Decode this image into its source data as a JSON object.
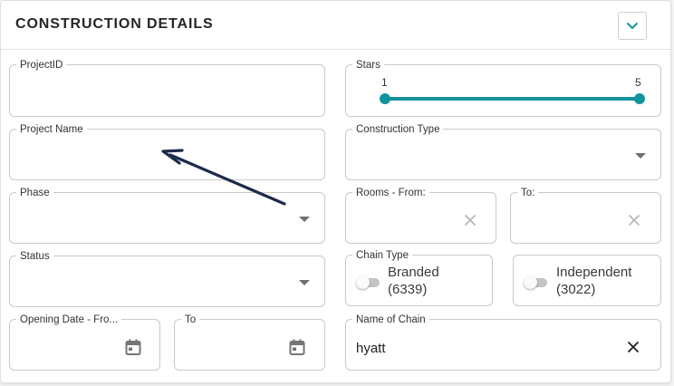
{
  "header": {
    "title": "CONSTRUCTION DETAILS",
    "collapse_icon": "chevron-down-icon"
  },
  "colors": {
    "accent": "#11939b",
    "arrow": "#1e2a4a"
  },
  "fields": {
    "project_id": {
      "label": "ProjectID",
      "value": ""
    },
    "project_name": {
      "label": "Project Name",
      "value": ""
    },
    "phase": {
      "label": "Phase",
      "value": ""
    },
    "status": {
      "label": "Status",
      "value": ""
    },
    "opening_from": {
      "label": "Opening Date - Fro...",
      "value": ""
    },
    "opening_to": {
      "label": "To",
      "value": ""
    },
    "stars": {
      "label": "Stars",
      "min_label": "1",
      "max_label": "5",
      "min": 1,
      "max": 5
    },
    "construction_type": {
      "label": "Construction Type",
      "value": ""
    },
    "rooms_from": {
      "label": "Rooms - From:",
      "value": ""
    },
    "rooms_to": {
      "label": "To:",
      "value": ""
    },
    "chain_type": {
      "label": "Chain Type",
      "branded_line1": "Branded",
      "branded_line2": "(6339)",
      "independent_line1": "Independent",
      "independent_line2": "(3022)"
    },
    "name_of_chain": {
      "label": "Name of Chain",
      "value": "hyatt"
    }
  }
}
